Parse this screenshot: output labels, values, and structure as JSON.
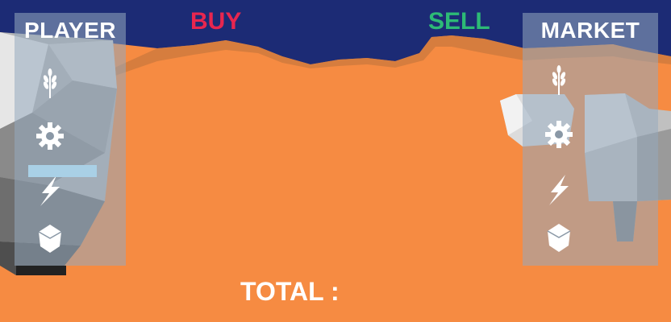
{
  "header": {
    "buy_label": "BUY",
    "sell_label": "SELL",
    "buy_color": "#e8264f",
    "sell_color": "#2dba76",
    "sky_color": "#1c2b75",
    "ground_color": "#f68b42"
  },
  "player_panel": {
    "title": "PLAYER",
    "resources": [
      {
        "icon": "wheat-icon"
      },
      {
        "icon": "gear-icon"
      },
      {
        "icon": "lightning-icon"
      },
      {
        "icon": "crystal-icon"
      }
    ]
  },
  "market_panel": {
    "title": "MARKET",
    "resources": [
      {
        "icon": "wheat-icon"
      },
      {
        "icon": "gear-icon"
      },
      {
        "icon": "lightning-icon"
      },
      {
        "icon": "crystal-icon"
      }
    ]
  },
  "footer": {
    "total_label": "TOTAL :"
  }
}
